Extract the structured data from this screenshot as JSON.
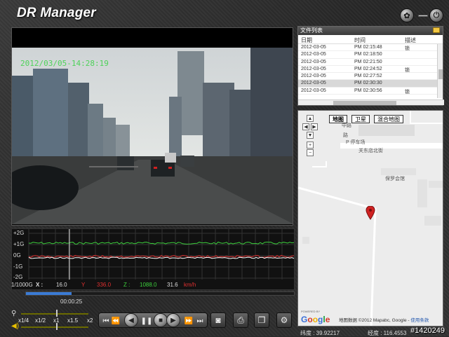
{
  "app": {
    "title": "DR Manager",
    "colors": {
      "accent": "#3a7bd5",
      "osd": "#4fd25a",
      "gx": "#ffffff",
      "gy": "#e03030",
      "gz": "#3ccf3c"
    }
  },
  "video": {
    "osd_timestamp": "2012/03/05-14:28:19"
  },
  "graph": {
    "labels": [
      "+2G",
      "+1G",
      "0G",
      "-1G",
      "-2G"
    ]
  },
  "readout": {
    "scale": "1/1000G",
    "x_label": "X :",
    "x_value": "16.0",
    "y_label": "Y",
    "y_value": "336.0",
    "z_label": "Z :",
    "z_value": "1088.0",
    "speed_value": "31.6",
    "speed_unit": "km/h"
  },
  "timeline": {
    "progress": 0.17,
    "timecode": "00:00:25"
  },
  "speed": {
    "options": [
      "x1/4",
      "x1/2",
      "x1",
      "x1.5",
      "x2"
    ]
  },
  "files": {
    "header": "文件列表",
    "columns": [
      "日期",
      "时间",
      "描述"
    ],
    "rows": [
      {
        "date": "2012-03-05",
        "time": "PM 02:15:48",
        "desc": "锁"
      },
      {
        "date": "2012-03-05",
        "time": "PM 02:18:50",
        "desc": ""
      },
      {
        "date": "2012-03-05",
        "time": "PM 02:21:50",
        "desc": ""
      },
      {
        "date": "2012-03-05",
        "time": "PM 02:24:52",
        "desc": "锁"
      },
      {
        "date": "2012-03-05",
        "time": "PM 02:27:52",
        "desc": ""
      },
      {
        "date": "2012-03-05",
        "time": "PM 02:30:30",
        "desc": ""
      },
      {
        "date": "2012-03-05",
        "time": "PM 02:30:56",
        "desc": "锁"
      }
    ]
  },
  "map": {
    "tabs": [
      "地图",
      "卫星",
      "混合地图"
    ],
    "active_tab": "地图",
    "labels": {
      "parking": "P 停车场",
      "road": "关东店北街",
      "place": "保罗会馆",
      "road_v": "中路",
      "road_v2": "路"
    },
    "powered_by": "POWERED BY",
    "google": "Google",
    "copyright": "地图数据 ©2012 Mapabc, Google -",
    "terms": "使用条款"
  },
  "coords": {
    "lat": "纬度 : 39.92217",
    "lng": "经度 : 116.4553"
  },
  "watermark": "#1420249"
}
